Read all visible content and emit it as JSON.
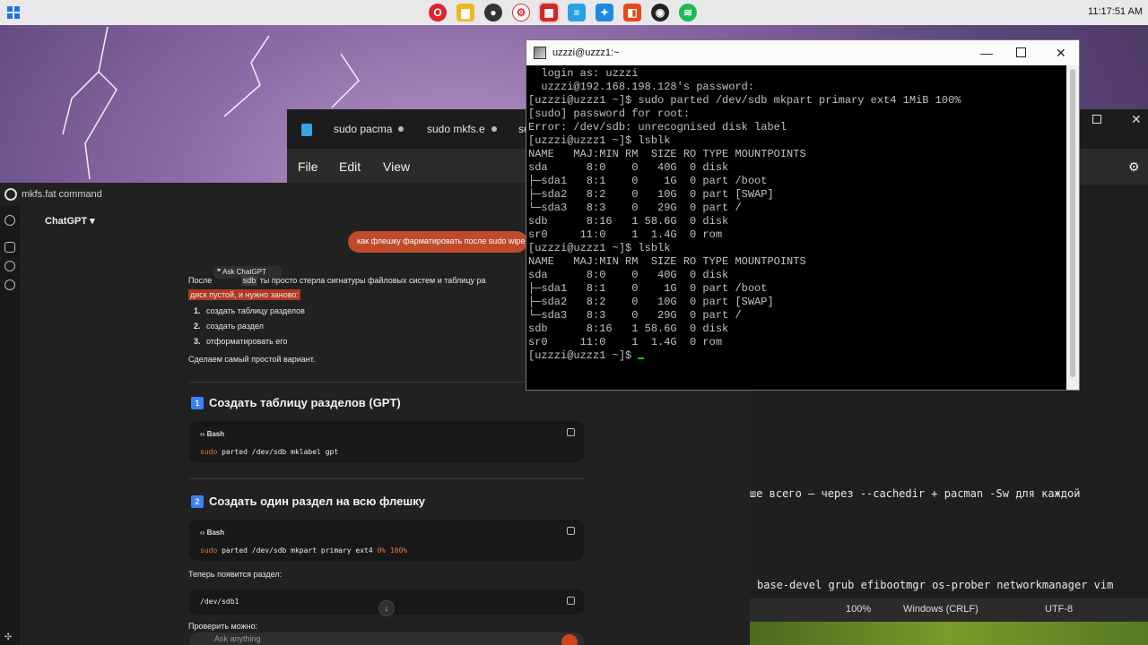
{
  "taskbar": {
    "clock": "11:17:51 AM",
    "icons": [
      "opera-icon",
      "file-explorer-icon",
      "obs-icon",
      "chatgpt-icon",
      "putty-icon",
      "notepad-icon",
      "vscode-icon",
      "teams-icon",
      "github-icon",
      "spotify-icon"
    ]
  },
  "editor": {
    "tabs": [
      "sudo pacma",
      "sudo mkfs.e",
      "su"
    ],
    "menu": [
      "File",
      "Edit",
      "View"
    ],
    "lines": [
      "ше всего — через --cachedir + pacman -Sw для каждой",
      "base-devel grub efibootmgr os-prober networkmanager vim"
    ],
    "status": {
      "zoom": "100%",
      "line_endings": "Windows (CRLF)",
      "encoding": "UTF-8"
    }
  },
  "chat": {
    "window_title": "mkfs.fat command",
    "model": "ChatGPT",
    "user_message": "как флешку фарматировать после sudo wipe",
    "ask_popup": "Ask ChatGPT",
    "answer": {
      "intro_prefix": "После",
      "intro_chip": "sdb",
      "intro_rest": "ты просто стерла сигнатуры файловых систем и таблицу ра",
      "intro_line2": "диск пустой, и нужно заново:",
      "steps": [
        "создать таблицу разделов",
        "создать раздел",
        "отформатировать его"
      ],
      "simple": "Сделаем самый простой вариант.",
      "section1": {
        "num": "1",
        "title": "Создать таблицу разделов (GPT)",
        "lang": "Bash",
        "code": "parted /dev/sdb mklabel gpt",
        "cmd": "sudo"
      },
      "section2": {
        "num": "2",
        "title": "Создать один раздел на всю флешку",
        "lang": "Bash",
        "cmd": "sudo",
        "code": "parted /dev/sdb mkpart primary ext4 ",
        "p0": "0%",
        "p100": "100%"
      },
      "after": "Теперь появится раздел:",
      "device": "/dev/sdb1",
      "check": "Проверить можно:"
    },
    "input_placeholder": "Ask anything"
  },
  "putty": {
    "title": "uzzzi@uzzz1:~",
    "lines": [
      "  login as: uzzzi",
      "  uzzzi@192.168.198.128's password:",
      "[uzzzi@uzzz1 ~]$ sudo parted /dev/sdb mkpart primary ext4 1MiB 100%",
      "[sudo] password for root:",
      "Error: /dev/sdb: unrecognised disk label",
      "[uzzzi@uzzz1 ~]$ lsblk",
      "NAME   MAJ:MIN RM  SIZE RO TYPE MOUNTPOINTS",
      "sda      8:0    0   40G  0 disk",
      "├─sda1   8:1    0    1G  0 part /boot",
      "├─sda2   8:2    0   10G  0 part [SWAP]",
      "└─sda3   8:3    0   29G  0 part /",
      "sdb      8:16   1 58.6G  0 disk",
      "sr0     11:0    1  1.4G  0 rom",
      "[uzzzi@uzzz1 ~]$ lsblk",
      "NAME   MAJ:MIN RM  SIZE RO TYPE MOUNTPOINTS",
      "sda      8:0    0   40G  0 disk",
      "├─sda1   8:1    0    1G  0 part /boot",
      "├─sda2   8:2    0   10G  0 part [SWAP]",
      "└─sda3   8:3    0   29G  0 part /",
      "sdb      8:16   1 58.6G  0 disk",
      "sr0     11:0    1  1.4G  0 rom"
    ],
    "prompt": "[uzzzi@uzzz1 ~]$ "
  }
}
